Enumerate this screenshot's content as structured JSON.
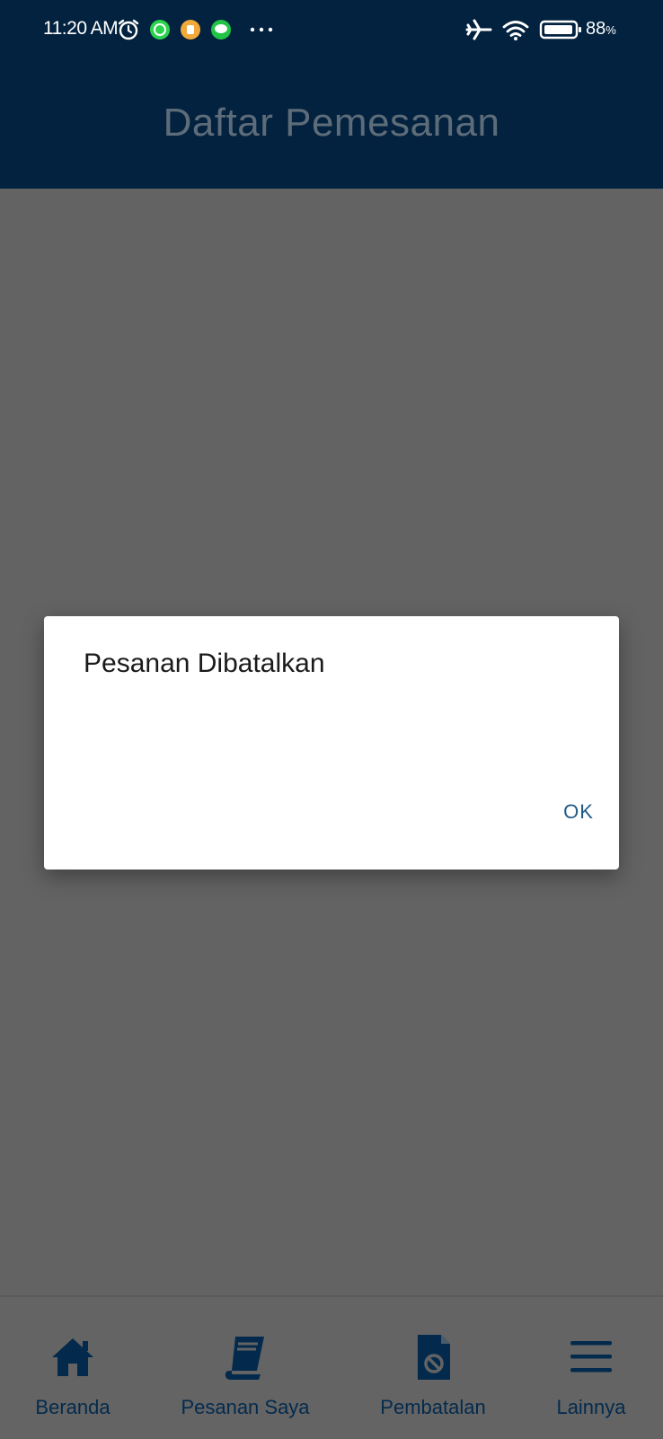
{
  "status_bar": {
    "time": "11:20 AM",
    "battery": "88",
    "battery_unit": "%",
    "icons": [
      "alarm-icon",
      "whatsapp-icon",
      "notification-app-icon",
      "line-icon",
      "more-dots-icon",
      "airplane-mode-icon",
      "wifi-icon",
      "battery-icon"
    ]
  },
  "header": {
    "title": "Daftar Pemesanan"
  },
  "dialog": {
    "title": "Pesanan Dibatalkan",
    "ok_label": "OK"
  },
  "bottom_nav": {
    "items": [
      {
        "label": "Beranda",
        "icon": "home-icon"
      },
      {
        "label": "Pesanan Saya",
        "icon": "book-icon"
      },
      {
        "label": "Pembatalan",
        "icon": "cancel-document-icon"
      },
      {
        "label": "Lainnya",
        "icon": "menu-icon"
      }
    ]
  },
  "colors": {
    "header_bg": "#03223f",
    "overlay_bg": "#636363",
    "nav_icon": "#032a4d",
    "ok_text": "#1f5a86"
  }
}
